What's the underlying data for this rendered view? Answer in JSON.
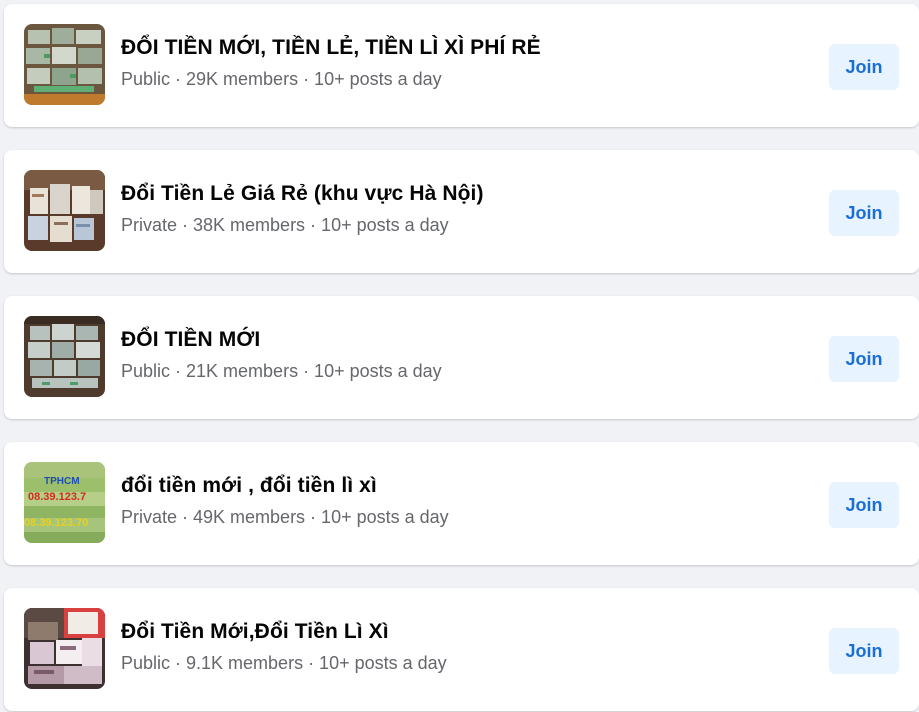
{
  "groups": [
    {
      "title": "ĐỔI TIỀN MỚI, TIỀN LẺ, TIỀN LÌ XÌ PHÍ RẺ",
      "meta": "Public · 29K members · 10+ posts a day",
      "join_label": "Join",
      "thumbnail_icon": "money-stacks-photo"
    },
    {
      "title": "Đổi Tiền Lẻ Giá Rẻ (khu vực Hà Nội)",
      "meta": "Private · 38K members · 10+ posts a day",
      "join_label": "Join",
      "thumbnail_icon": "banknote-bundles-photo"
    },
    {
      "title": "ĐỔI TIỀN MỚI",
      "meta": "Public · 21K members · 10+ posts a day",
      "join_label": "Join",
      "thumbnail_icon": "money-stacks-photo"
    },
    {
      "title": "đổi tiền mới , đổi tiền lì xì",
      "meta": "Private · 49K members · 10+ posts a day",
      "join_label": "Join",
      "thumbnail_icon": "money-stacks-phone-number-photo",
      "thumbnail_text": [
        "TPHCM",
        "08.39.123.7",
        "08.39.123.70"
      ]
    },
    {
      "title": "Đổi Tiền Mới,Đổi Tiền Lì Xì",
      "meta": "Public · 9.1K members · 10+ posts a day",
      "join_label": "Join",
      "thumbnail_icon": "banknote-packages-photo"
    }
  ],
  "colors": {
    "background": "#f0f2f5",
    "card": "#ffffff",
    "title": "#050505",
    "meta": "#65676b",
    "join_bg": "#e7f3ff",
    "join_text": "#1a6ed8"
  }
}
